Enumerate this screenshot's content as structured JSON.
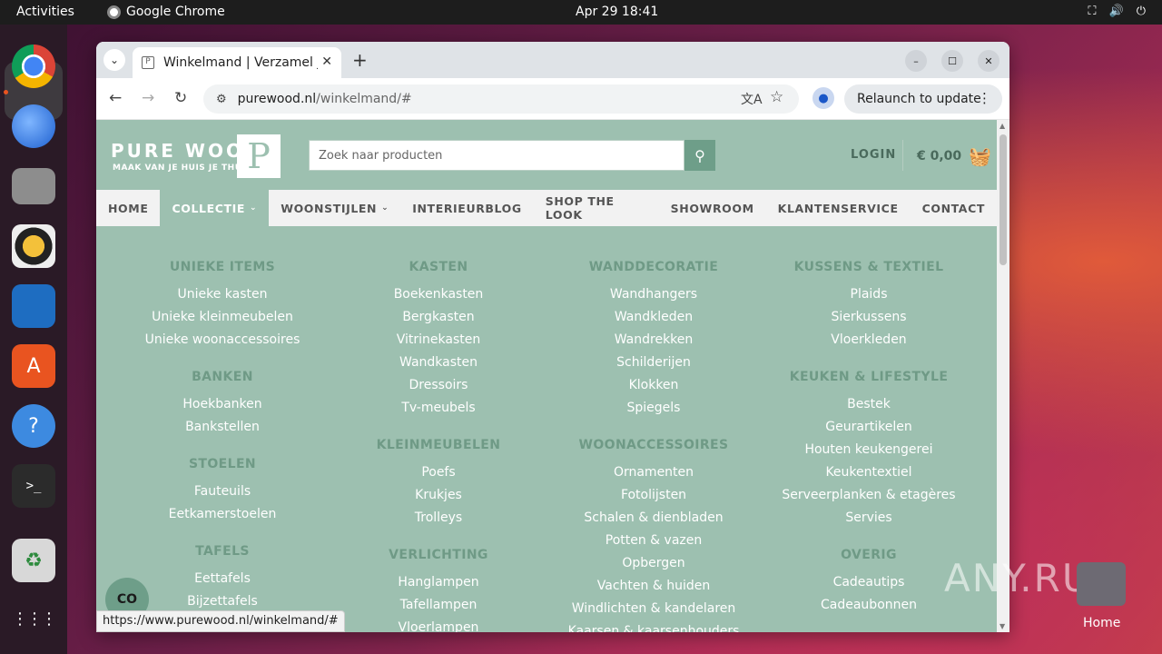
{
  "topbar": {
    "activities": "Activities",
    "app_name": "Google Chrome",
    "clock": "Apr 29  18:41",
    "tray": {
      "network": "⛶",
      "volume": "🔊",
      "power": "⏻"
    }
  },
  "dock": {
    "items": [
      "chrome-icon",
      "thunderbird-icon",
      "files-icon",
      "rhythmbox-icon",
      "writer-icon",
      "app-center-icon",
      "help-icon",
      "terminal-icon",
      "trash-icon",
      "apps-grid-icon"
    ],
    "icon_glyphs": {
      "help": "?",
      "terminal": ">_",
      "trash": "♻",
      "apps": "⋮⋮⋮"
    }
  },
  "browser": {
    "tab": {
      "title": "Winkelmand | Verzamel je",
      "close": "✕"
    },
    "new_tab": "+",
    "toolbar": {
      "back": "←",
      "forward": "→",
      "reload": "↻",
      "url_host": "purewood.nl",
      "url_path": "/winkelmand/#",
      "relaunch": "Relaunch to update",
      "kebab": "⋮"
    },
    "window_controls": {
      "minimize": "–",
      "maximize": "☐",
      "close": "✕"
    }
  },
  "site": {
    "logo": {
      "brand": "PURE WOOD",
      "tagline": "MAAK VAN JE HUIS JE THUIS",
      "mark": "P"
    },
    "search": {
      "placeholder": "Zoek naar producten",
      "icon": "⚲"
    },
    "login": "LOGIN",
    "cart": {
      "amount": "€ 0,00",
      "icon": "🧺"
    },
    "nav": [
      {
        "label": "HOME",
        "chevron": ""
      },
      {
        "label": "COLLECTIE",
        "chevron": "⌄"
      },
      {
        "label": "WOONSTIJLEN",
        "chevron": "⌄"
      },
      {
        "label": "INTERIEURBLOG",
        "chevron": ""
      },
      {
        "label": "SHOP THE LOOK",
        "chevron": ""
      },
      {
        "label": "SHOWROOM",
        "chevron": ""
      },
      {
        "label": "KLANTENSERVICE",
        "chevron": ""
      },
      {
        "label": "CONTACT",
        "chevron": ""
      }
    ],
    "megamenu": {
      "col1": [
        {
          "head": "UNIEKE ITEMS",
          "links": [
            "Unieke kasten",
            "Unieke kleinmeubelen",
            "Unieke woonaccessoires"
          ]
        },
        {
          "head": "BANKEN",
          "links": [
            "Hoekbanken",
            "Bankstellen"
          ]
        },
        {
          "head": "STOELEN",
          "links": [
            "Fauteuils",
            "Eetkamerstoelen"
          ]
        },
        {
          "head": "TAFELS",
          "links": [
            "Eettafels",
            "Bijzettafels"
          ]
        }
      ],
      "col2": [
        {
          "head": "KASTEN",
          "links": [
            "Boekenkasten",
            "Bergkasten",
            "Vitrinekasten",
            "Wandkasten",
            "Dressoirs",
            "Tv-meubels"
          ]
        },
        {
          "head": "KLEINMEUBELEN",
          "links": [
            "Poefs",
            "Krukjes",
            "Trolleys"
          ]
        },
        {
          "head": "VERLICHTING",
          "links": [
            "Hanglampen",
            "Tafellampen",
            "Vloerlampen"
          ]
        }
      ],
      "col3": [
        {
          "head": "WANDDECORATIE",
          "links": [
            "Wandhangers",
            "Wandkleden",
            "Wandrekken",
            "Schilderijen",
            "Klokken",
            "Spiegels"
          ]
        },
        {
          "head": "WOONACCESSOIRES",
          "links": [
            "Ornamenten",
            "Fotolijsten",
            "Schalen & dienbladen",
            "Potten & vazen",
            "Opbergen",
            "Vachten & huiden",
            "Windlichten & kandelaren",
            "Kaarsen & kaarsenhouders"
          ]
        }
      ],
      "col4": [
        {
          "head": "KUSSENS & TEXTIEL",
          "links": [
            "Plaids",
            "Sierkussens",
            "Vloerkleden"
          ]
        },
        {
          "head": "KEUKEN & LIFESTYLE",
          "links": [
            "Bestek",
            "Geurartikelen",
            "Houten keukengerei",
            "Keukentextiel",
            "Serveerplanken & etagères",
            "Servies"
          ]
        },
        {
          "head": "OVERIG",
          "links": [
            "Cadeautips",
            "Cadeaubonnen"
          ]
        }
      ]
    },
    "cookie_button": "CO",
    "status_url": "https://www.purewood.nl/winkelmand/#"
  },
  "watermark": "ANY.RUN",
  "desktop": {
    "home_label": "Home"
  },
  "colors": {
    "page_bg": "#9dc0b0",
    "heading": "#6f9a86",
    "accent": "#6e9e89",
    "ubuntu_orange": "#e95420"
  }
}
